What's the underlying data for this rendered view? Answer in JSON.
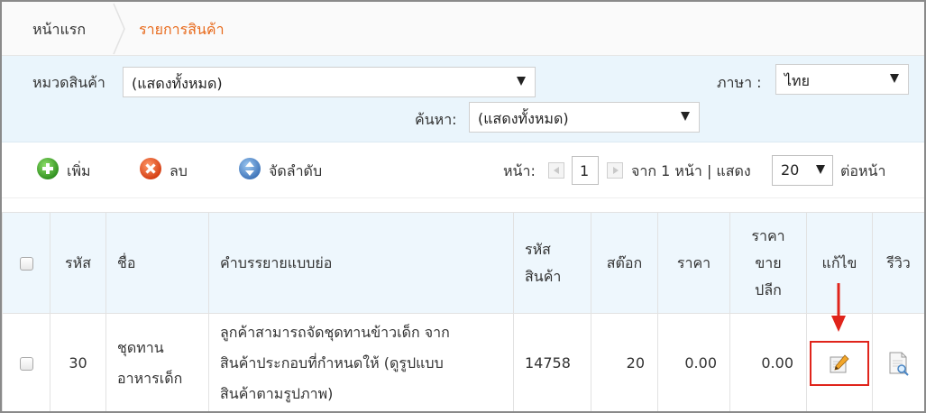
{
  "breadcrumb": {
    "home": "หน้าแรก",
    "current": "รายการสินค้า"
  },
  "filter": {
    "category_label": "หมวดสินค้า",
    "category_value": "(แสดงทั้งหมด)",
    "language_label": "ภาษา :",
    "language_value": "ไทย",
    "search_label": "ค้นหา:",
    "search_value": "(แสดงทั้งหมด)"
  },
  "toolbar": {
    "add_label": "เพิ่ม",
    "delete_label": "ลบ",
    "sort_label": "จัดลำดับ",
    "page_label": "หน้า:",
    "page_value": "1",
    "of_pages": "จาก 1 หน้า | แสดง",
    "per_page_value": "20",
    "per_page_suffix": "ต่อหน้า"
  },
  "table": {
    "headers": {
      "id": "รหัส",
      "name": "ชื่อ",
      "description": "คำบรรยายแบบย่อ",
      "sku_1": "รหัส",
      "sku_2": "สินค้า",
      "stock": "สต๊อก",
      "price": "ราคา",
      "retail_1": "ราคา",
      "retail_2": "ขาย",
      "retail_3": "ปลีก",
      "edit": "แก้ไข",
      "review": "รีวิว"
    },
    "rows": [
      {
        "id": "30",
        "name_1": "ชุดทาน",
        "name_2": "อาหารเด็ก",
        "desc_1": "ลูกค้าสามารถจัดชุดทานข้าวเด็ก จาก",
        "desc_2": "สินค้าประกอบที่กำหนดให้ (ดูรูปแบบ",
        "desc_3": "สินค้าตามรูปภาพ)",
        "sku": "14758",
        "stock": "20",
        "price": "0.00",
        "retail": "0.00"
      }
    ]
  },
  "colors": {
    "accent": "#e86a1c",
    "highlight": "#e0241b",
    "panel": "#eaf5fc"
  },
  "icons": [
    "plus-circle-icon",
    "x-circle-icon",
    "sort-circle-icon",
    "pencil-edit-icon",
    "review-document-icon",
    "down-arrow-icon"
  ]
}
